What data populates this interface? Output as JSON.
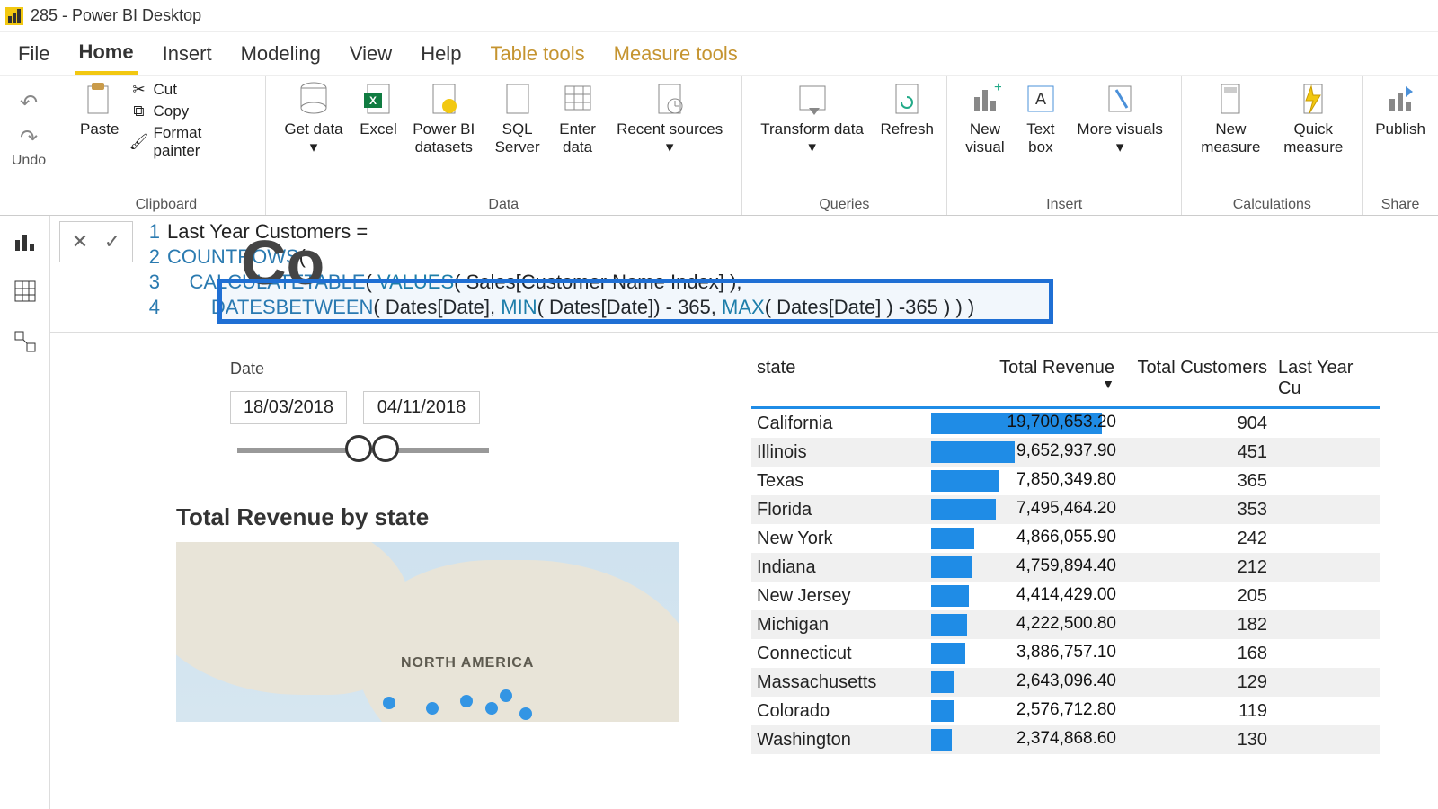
{
  "window_title": "285 - Power BI Desktop",
  "menu": {
    "file": "File",
    "home": "Home",
    "insert": "Insert",
    "modeling": "Modeling",
    "view": "View",
    "help": "Help",
    "table_tools": "Table tools",
    "measure_tools": "Measure tools"
  },
  "ribbon": {
    "undo_label": "Undo",
    "paste": "Paste",
    "cut": "Cut",
    "copy": "Copy",
    "format_painter": "Format painter",
    "clipboard": "Clipboard",
    "get_data": "Get data",
    "excel": "Excel",
    "pbi_datasets": "Power BI datasets",
    "sql_server": "SQL Server",
    "enter_data": "Enter data",
    "recent_sources": "Recent sources",
    "data": "Data",
    "transform_data": "Transform data",
    "refresh": "Refresh",
    "queries": "Queries",
    "new_visual": "New visual",
    "text_box": "Text box",
    "more_visuals": "More visuals",
    "insert": "Insert",
    "new_measure": "New measure",
    "quick_measure": "Quick measure",
    "calculations": "Calculations",
    "publish": "Publish",
    "share": "Share"
  },
  "formula": {
    "l1": "Last Year Customers =",
    "l2_func": "COUNTROWS",
    "l2_rest": "(",
    "l3_func": "CALCULATETABLE",
    "l3_mid": "( ",
    "l3_func2": "VALUES",
    "l3_rest": "( Sales[Customer Name Index] ),",
    "l4_func": "DATESBETWEEN",
    "l4_mid": "( Dates[Date], ",
    "l4_func2": "MIN",
    "l4_mid2": "( Dates[Date]) - 365, ",
    "l4_func3": "MAX",
    "l4_rest": "( Dates[Date] ) -365 ) ) )"
  },
  "bg_title": "Co",
  "slicer": {
    "label": "Date",
    "from": "18/03/2018",
    "to": "04/11/2018"
  },
  "map_title": "Total Revenue by state",
  "map_label": "NORTH AMERICA",
  "table": {
    "headers": {
      "state": "state",
      "rev": "Total Revenue",
      "cust": "Total Customers",
      "ly": "Last Year Cu"
    },
    "rows": [
      {
        "state": "California",
        "rev": "19,700,653.20",
        "revpct": 100,
        "cust": "904"
      },
      {
        "state": "Illinois",
        "rev": "9,652,937.90",
        "revpct": 49,
        "cust": "451"
      },
      {
        "state": "Texas",
        "rev": "7,850,349.80",
        "revpct": 40,
        "cust": "365"
      },
      {
        "state": "Florida",
        "rev": "7,495,464.20",
        "revpct": 38,
        "cust": "353"
      },
      {
        "state": "New York",
        "rev": "4,866,055.90",
        "revpct": 25,
        "cust": "242"
      },
      {
        "state": "Indiana",
        "rev": "4,759,894.40",
        "revpct": 24,
        "cust": "212"
      },
      {
        "state": "New Jersey",
        "rev": "4,414,429.00",
        "revpct": 22,
        "cust": "205"
      },
      {
        "state": "Michigan",
        "rev": "4,222,500.80",
        "revpct": 21,
        "cust": "182"
      },
      {
        "state": "Connecticut",
        "rev": "3,886,757.10",
        "revpct": 20,
        "cust": "168"
      },
      {
        "state": "Massachusetts",
        "rev": "2,643,096.40",
        "revpct": 13,
        "cust": "129"
      },
      {
        "state": "Colorado",
        "rev": "2,576,712.80",
        "revpct": 13,
        "cust": "119"
      },
      {
        "state": "Washington",
        "rev": "2,374,868.60",
        "revpct": 12,
        "cust": "130"
      }
    ]
  },
  "chart_data": {
    "type": "table",
    "title": "Total Revenue by state",
    "columns": [
      "state",
      "Total Revenue",
      "Total Customers"
    ],
    "rows": [
      [
        "California",
        19700653.2,
        904
      ],
      [
        "Illinois",
        9652937.9,
        451
      ],
      [
        "Texas",
        7850349.8,
        365
      ],
      [
        "Florida",
        7495464.2,
        353
      ],
      [
        "New York",
        4866055.9,
        242
      ],
      [
        "Indiana",
        4759894.4,
        212
      ],
      [
        "New Jersey",
        4414429.0,
        205
      ],
      [
        "Michigan",
        4222500.8,
        182
      ],
      [
        "Connecticut",
        3886757.1,
        168
      ],
      [
        "Massachusetts",
        2643096.4,
        129
      ],
      [
        "Colorado",
        2576712.8,
        119
      ],
      [
        "Washington",
        2374868.6,
        130
      ]
    ]
  }
}
